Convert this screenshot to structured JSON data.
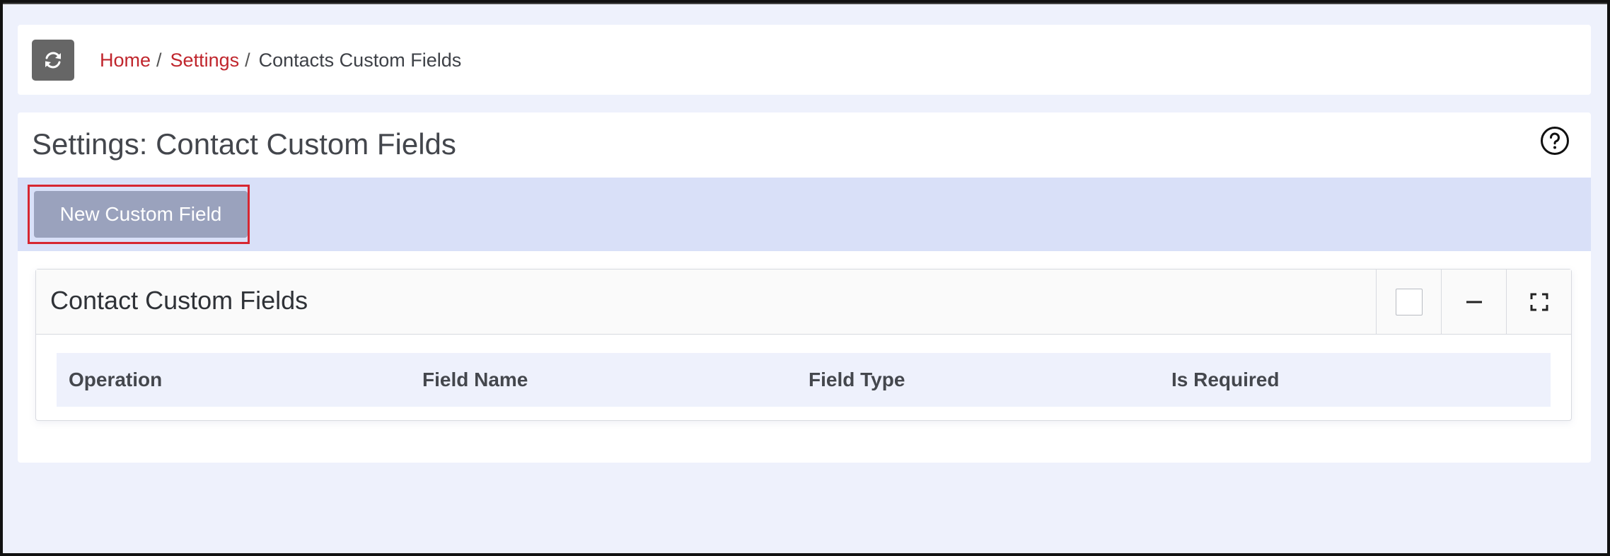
{
  "breadcrumb": {
    "refresh_icon": "refresh-icon",
    "items": [
      {
        "label": "Home",
        "link": true
      },
      {
        "label": "Settings",
        "link": true
      },
      {
        "label": "Contacts Custom Fields",
        "link": false
      }
    ],
    "separator": "/"
  },
  "page": {
    "title": "Settings: Contact Custom Fields",
    "help_icon": "question-circle-icon"
  },
  "actions": {
    "new_button_label": "New Custom Field"
  },
  "widget": {
    "title": "Contact Custom Fields",
    "tools": [
      "checkbox",
      "minimize-icon",
      "expand-icon"
    ]
  },
  "table": {
    "columns": [
      "Operation",
      "Field Name",
      "Field Type",
      "Is Required"
    ],
    "rows": []
  },
  "colors": {
    "accent_link": "#c0262d",
    "highlight": "#d72631",
    "action_bar": "#d9e0f8",
    "page_bg": "#eef1fc",
    "button_bg": "#9aa2bd"
  }
}
